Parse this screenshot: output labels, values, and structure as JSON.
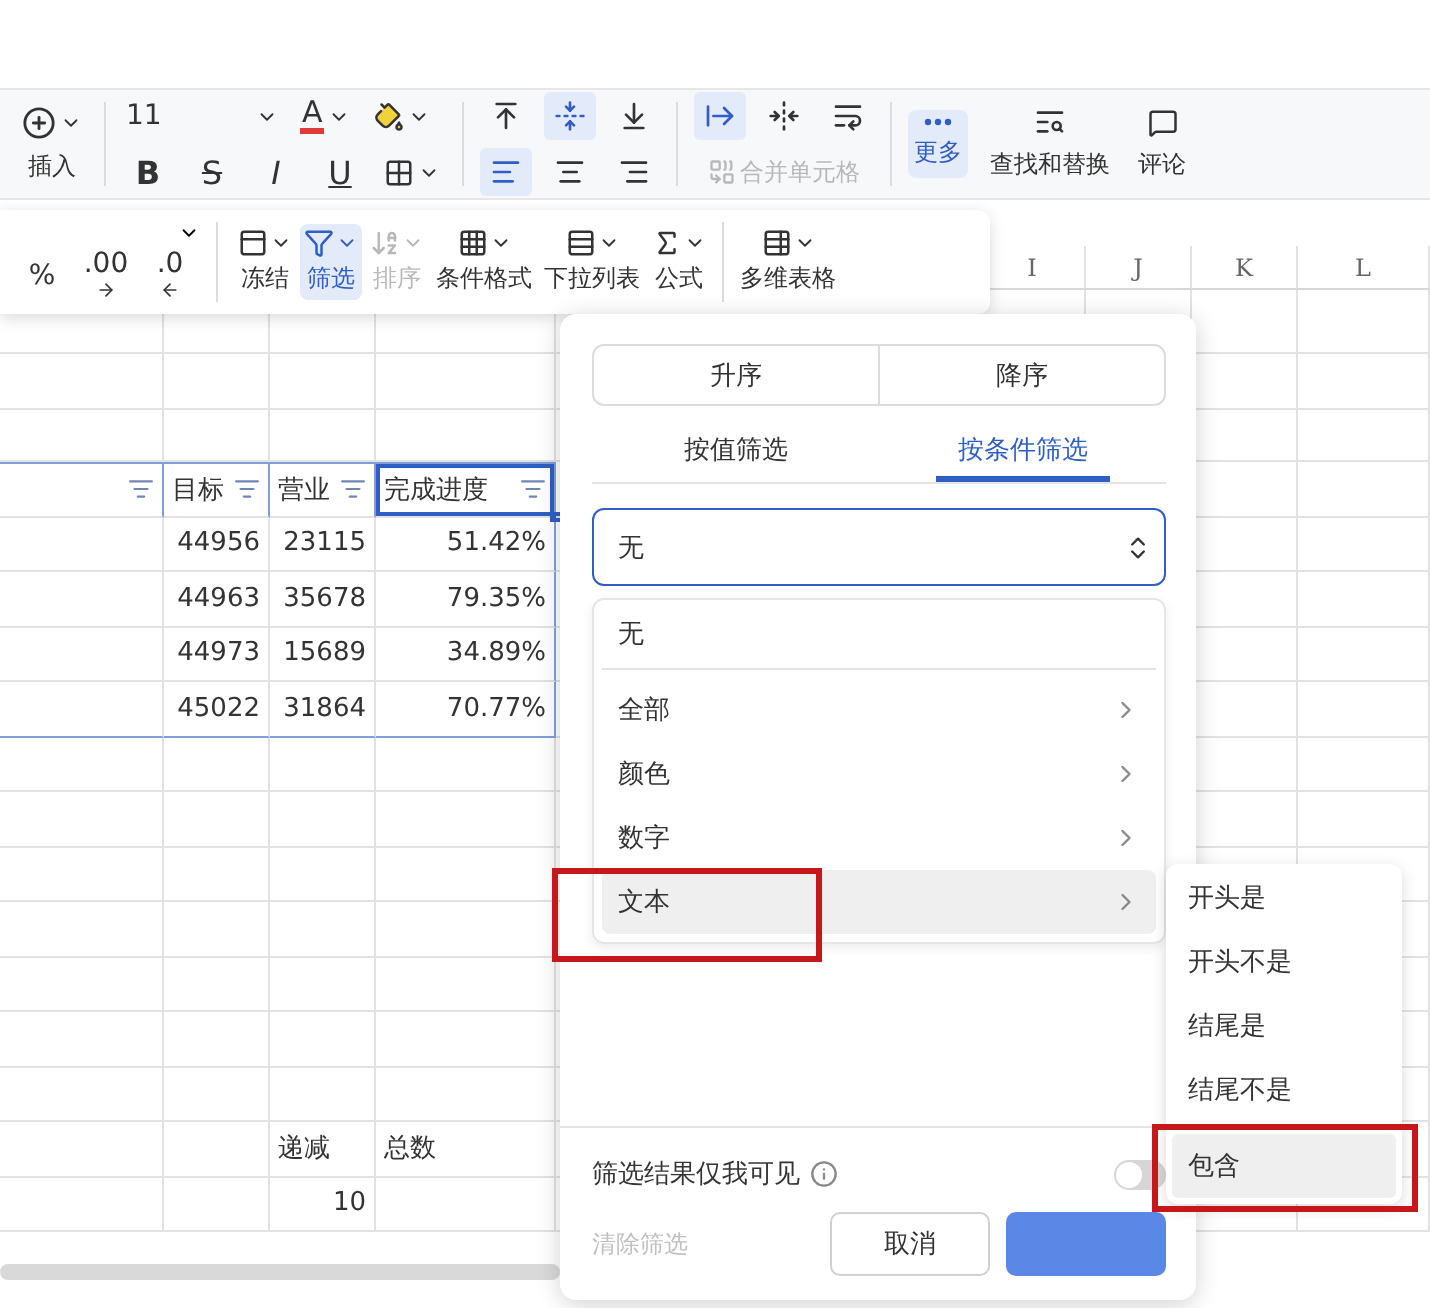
{
  "toolbar": {
    "insert": {
      "label": "插入"
    },
    "font_size": "11",
    "font_color": {
      "label": "A",
      "color": "#e03a3a"
    },
    "format_buttons": [
      {
        "kind": "bold",
        "label": "B"
      },
      {
        "kind": "strike",
        "label": "S"
      },
      {
        "kind": "italic",
        "label": "I"
      },
      {
        "kind": "underline",
        "label": "U"
      }
    ],
    "vertical_align": [
      {
        "kind": "top",
        "selected": false
      },
      {
        "kind": "middle",
        "selected": true
      },
      {
        "kind": "bottom",
        "selected": false
      }
    ],
    "horizontal_align": [
      {
        "kind": "left",
        "selected": true
      },
      {
        "kind": "center",
        "selected": false
      },
      {
        "kind": "right",
        "selected": false
      }
    ],
    "cell_tools": [
      {
        "kind": "indent",
        "selected": true
      },
      {
        "kind": "fit",
        "selected": false
      },
      {
        "kind": "wrap",
        "selected": false
      }
    ],
    "merge_cells": {
      "label": "合并单元格",
      "disabled": true
    },
    "more": {
      "label": "更多",
      "selected": true
    },
    "find_replace": {
      "label": "查找和替换"
    },
    "comment": {
      "label": "评论"
    }
  },
  "ribbon": {
    "number_formats": [
      {
        "kind": "percent",
        "label": "%"
      },
      {
        "kind": "add_decimal",
        "label": ".00"
      },
      {
        "kind": "remove_decimal",
        "label": ".0"
      }
    ],
    "items": [
      {
        "kind": "freeze",
        "label": "冻结",
        "selected": false,
        "disabled": false
      },
      {
        "kind": "filter",
        "label": "筛选",
        "selected": true,
        "disabled": false
      },
      {
        "kind": "sort",
        "label": "排序",
        "selected": false,
        "disabled": true
      },
      {
        "kind": "conditional",
        "label": "条件格式",
        "selected": false,
        "disabled": false
      },
      {
        "kind": "dropdown",
        "label": "下拉列表",
        "selected": false,
        "disabled": false
      },
      {
        "kind": "formula",
        "label": "公式",
        "selected": false,
        "disabled": false
      },
      {
        "kind": "table",
        "label": "多维表格",
        "selected": false,
        "disabled": false
      }
    ]
  },
  "sheet": {
    "column_headers": [
      "I",
      "J",
      "K",
      "L"
    ],
    "table": {
      "header": [
        {
          "selected": false
        },
        {
          "text": "目标",
          "selected": false
        },
        {
          "text": "营业",
          "selected": false
        },
        {
          "text": "完成进度",
          "selected": true
        }
      ],
      "rows": [
        [
          null,
          "44956",
          "23115",
          "51.42%"
        ],
        [
          null,
          "44963",
          "35678",
          "79.35%"
        ],
        [
          null,
          "44973",
          "15689",
          "34.89%"
        ],
        [
          null,
          "45022",
          "31864",
          "70.77%"
        ]
      ]
    },
    "extra_rows": [
      [
        null,
        null,
        {
          "kind": "text",
          "text": "递减"
        },
        {
          "kind": "text",
          "text": "总数"
        }
      ],
      [
        null,
        null,
        {
          "kind": "number",
          "text": "10"
        },
        null
      ]
    ]
  },
  "filter_panel": {
    "sort_buttons": [
      "升序",
      "降序"
    ],
    "tabs": [
      {
        "label": "按值筛选",
        "selected": false
      },
      {
        "label": "按条件筛选",
        "selected": true
      }
    ],
    "condition_select": {
      "value": "无"
    },
    "options": [
      {
        "label": "无",
        "submenu": false,
        "highlighted": false
      },
      {
        "label": "全部",
        "submenu": true,
        "highlighted": false
      },
      {
        "label": "颜色",
        "submenu": true,
        "highlighted": false
      },
      {
        "label": "数字",
        "submenu": true,
        "highlighted": false
      },
      {
        "label": "文本",
        "submenu": true,
        "highlighted": true
      }
    ],
    "submenu": [
      {
        "label": "开头是",
        "highlighted": false
      },
      {
        "label": "开头不是",
        "highlighted": false
      },
      {
        "label": "结尾是",
        "highlighted": false
      },
      {
        "label": "结尾不是",
        "highlighted": false
      },
      {
        "label": "包含",
        "highlighted": true
      }
    ],
    "private_toggle": {
      "label": "筛选结果仅我可见",
      "on": false
    },
    "clear": {
      "label": "清除筛选",
      "disabled": true
    },
    "cancel": {
      "label": "取消"
    }
  }
}
